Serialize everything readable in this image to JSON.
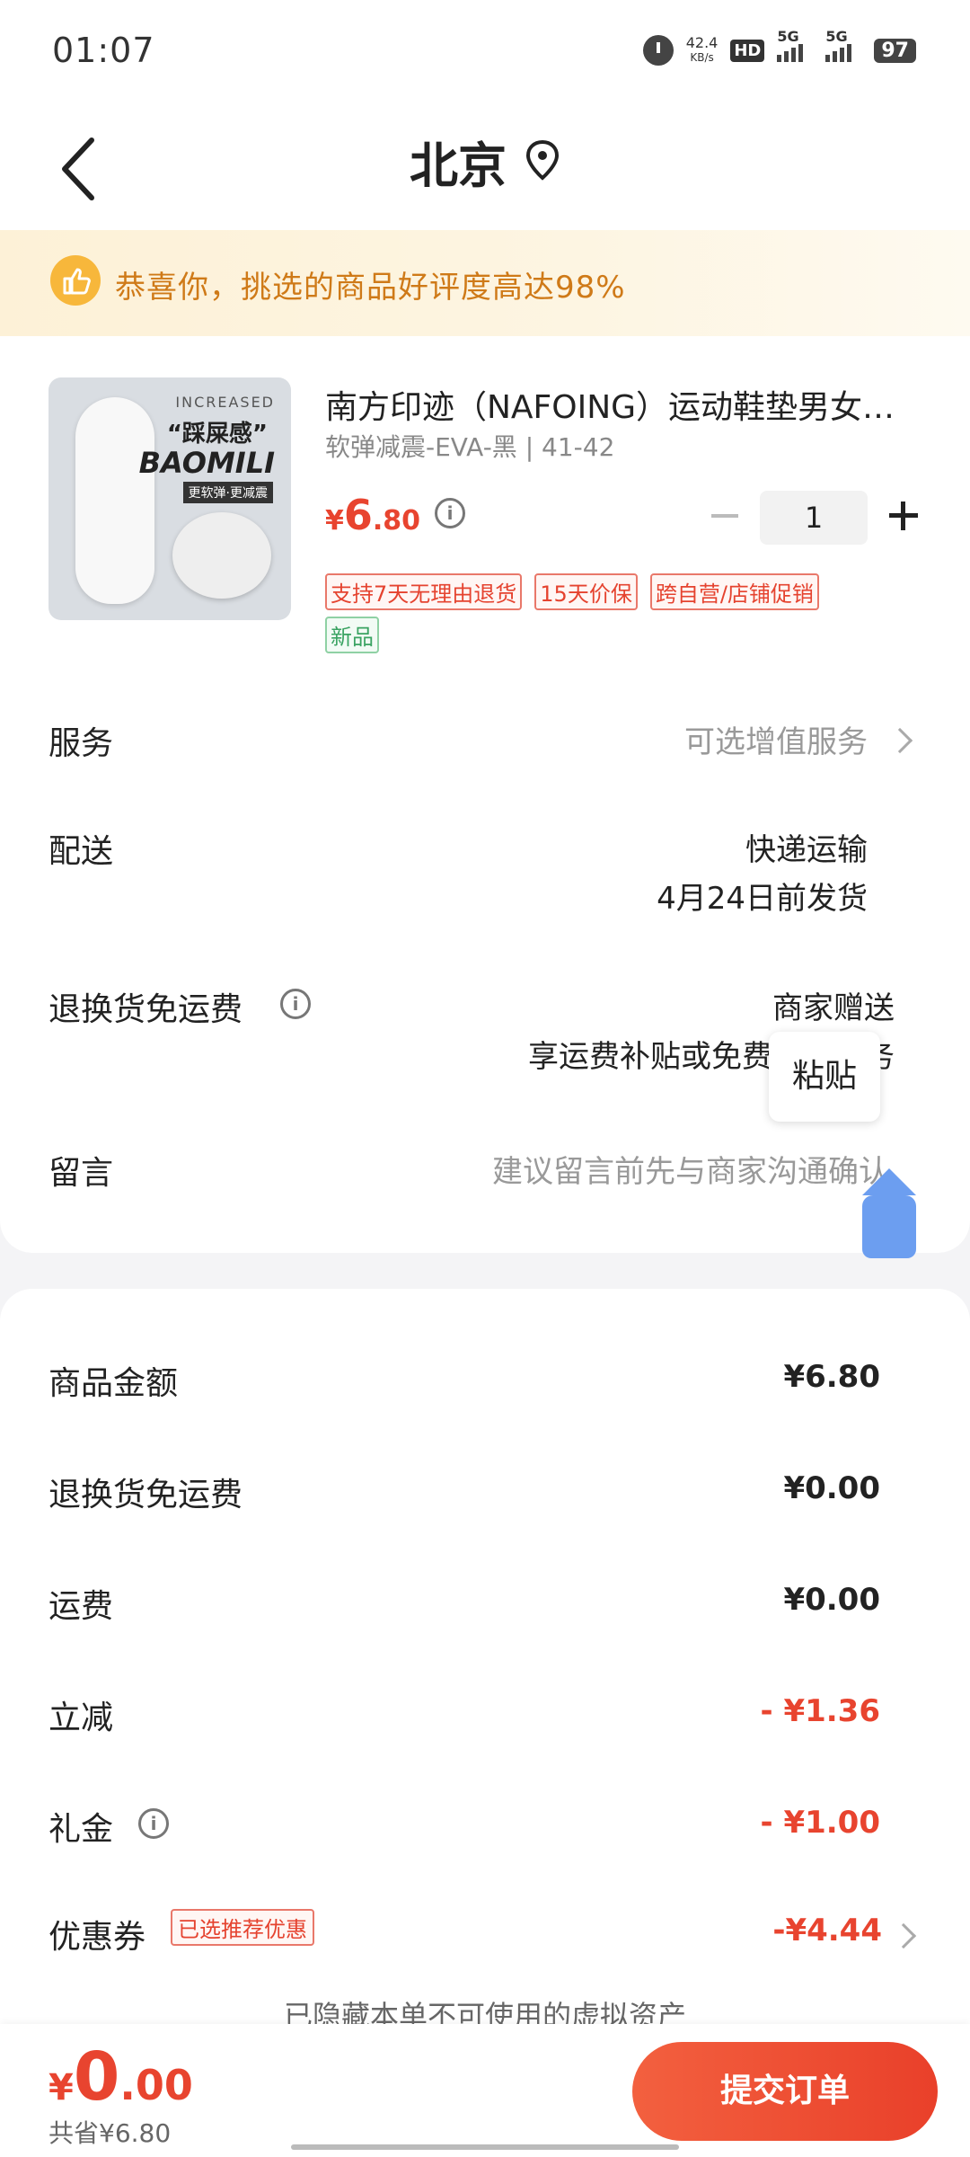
{
  "status_bar": {
    "time": "01:07",
    "net_speed": "42.4",
    "net_unit": "KB/s",
    "hd": "HD",
    "sig1": "5G",
    "sig2": "5G",
    "battery": "97"
  },
  "header": {
    "title": "北京",
    "icons": [
      "back-icon",
      "location-pin-icon"
    ]
  },
  "banner": {
    "text": "恭喜你，挑选的商品好评度高达98%",
    "icon": "thumbs-up-icon"
  },
  "product": {
    "title": "南方印迹（NAFOING）运动鞋垫男女款软弹减震EVA",
    "spec": "软弹减震-EVA-黑 | 41-42",
    "price_symbol": "¥",
    "price_int": "6",
    "price_dec": ".80",
    "quantity": "1",
    "image_text": {
      "line1": "INCREASED",
      "line2": "“踩屎感”",
      "line3": "BAOMILI",
      "line4": "更软弹·更减震"
    },
    "tags": [
      "支持7天无理由退货",
      "15天价保",
      "跨自营/店铺促销"
    ],
    "new_tag": "新品"
  },
  "rows": {
    "service_label": "服务",
    "service_value": "可选增值服务",
    "delivery_label": "配送",
    "delivery_value1": "快递运输",
    "delivery_value2": "4月24日前发货",
    "return_label": "退换货免运费",
    "return_value1": "商家赠送",
    "return_value2": "享运费补贴或免费取件服务",
    "message_label": "留言",
    "message_placeholder": "建议留言前先与商家沟通确认"
  },
  "popup": {
    "paste": "粘贴"
  },
  "summary": {
    "goods_label": "商品金额",
    "goods_value": "¥6.80",
    "return_fee_label": "退换货免运费",
    "return_fee_value": "¥0.00",
    "shipping_label": "运费",
    "shipping_value": "¥0.00",
    "instant_label": "立减",
    "instant_value": "- ¥1.36",
    "gift_label": "礼金",
    "gift_value": "- ¥1.00",
    "coupon_label": "优惠券",
    "coupon_tag": "已选推荐优惠",
    "coupon_value": "-¥4.44",
    "hidden_note": "已隐藏本单不可使用的虚拟资产"
  },
  "bottom": {
    "total_symbol": "¥",
    "total_int": "0",
    "total_dec": ".00",
    "saved": "共省¥6.80",
    "submit": "提交订单"
  },
  "colors": {
    "accent_red": "#e8442f",
    "banner_text": "#cf7a18"
  }
}
